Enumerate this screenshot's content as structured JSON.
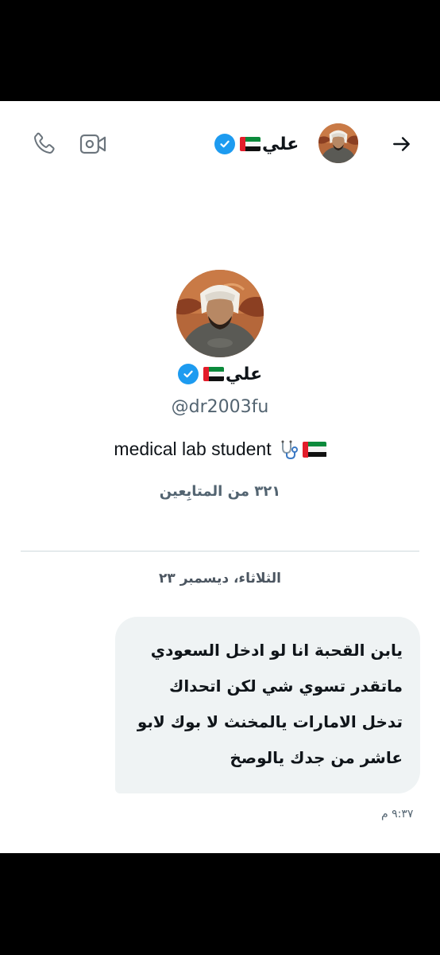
{
  "header": {
    "name": "علي",
    "flag": "UAE flag",
    "back_icon": "arrow-right-icon",
    "video_icon": "video-camera-icon",
    "phone_icon": "phone-icon"
  },
  "profile": {
    "name": "علي",
    "handle": "@dr2003fu",
    "bio_text": "medical lab student",
    "bio_emojis": [
      "stethoscope",
      "UAE flag"
    ],
    "followers": "٣٢١ من المتابِعين"
  },
  "conversation": {
    "date": "الثلاثاء، ديسمبر ٢٣",
    "messages": [
      {
        "lines": [
          "يابن القحبة انا لو ادخل السعودي",
          "ماتقدر تسوي شي لكن اتحداك",
          "تدخل الامارات يالمخنث  لا بوك لابو",
          "عاشر من جدك يالوصخ"
        ],
        "time": "٩:٣٧ م"
      }
    ]
  },
  "colors": {
    "accent": "#1d9bf0",
    "bubble": "#eff3f4",
    "secondary_text": "#536471"
  }
}
